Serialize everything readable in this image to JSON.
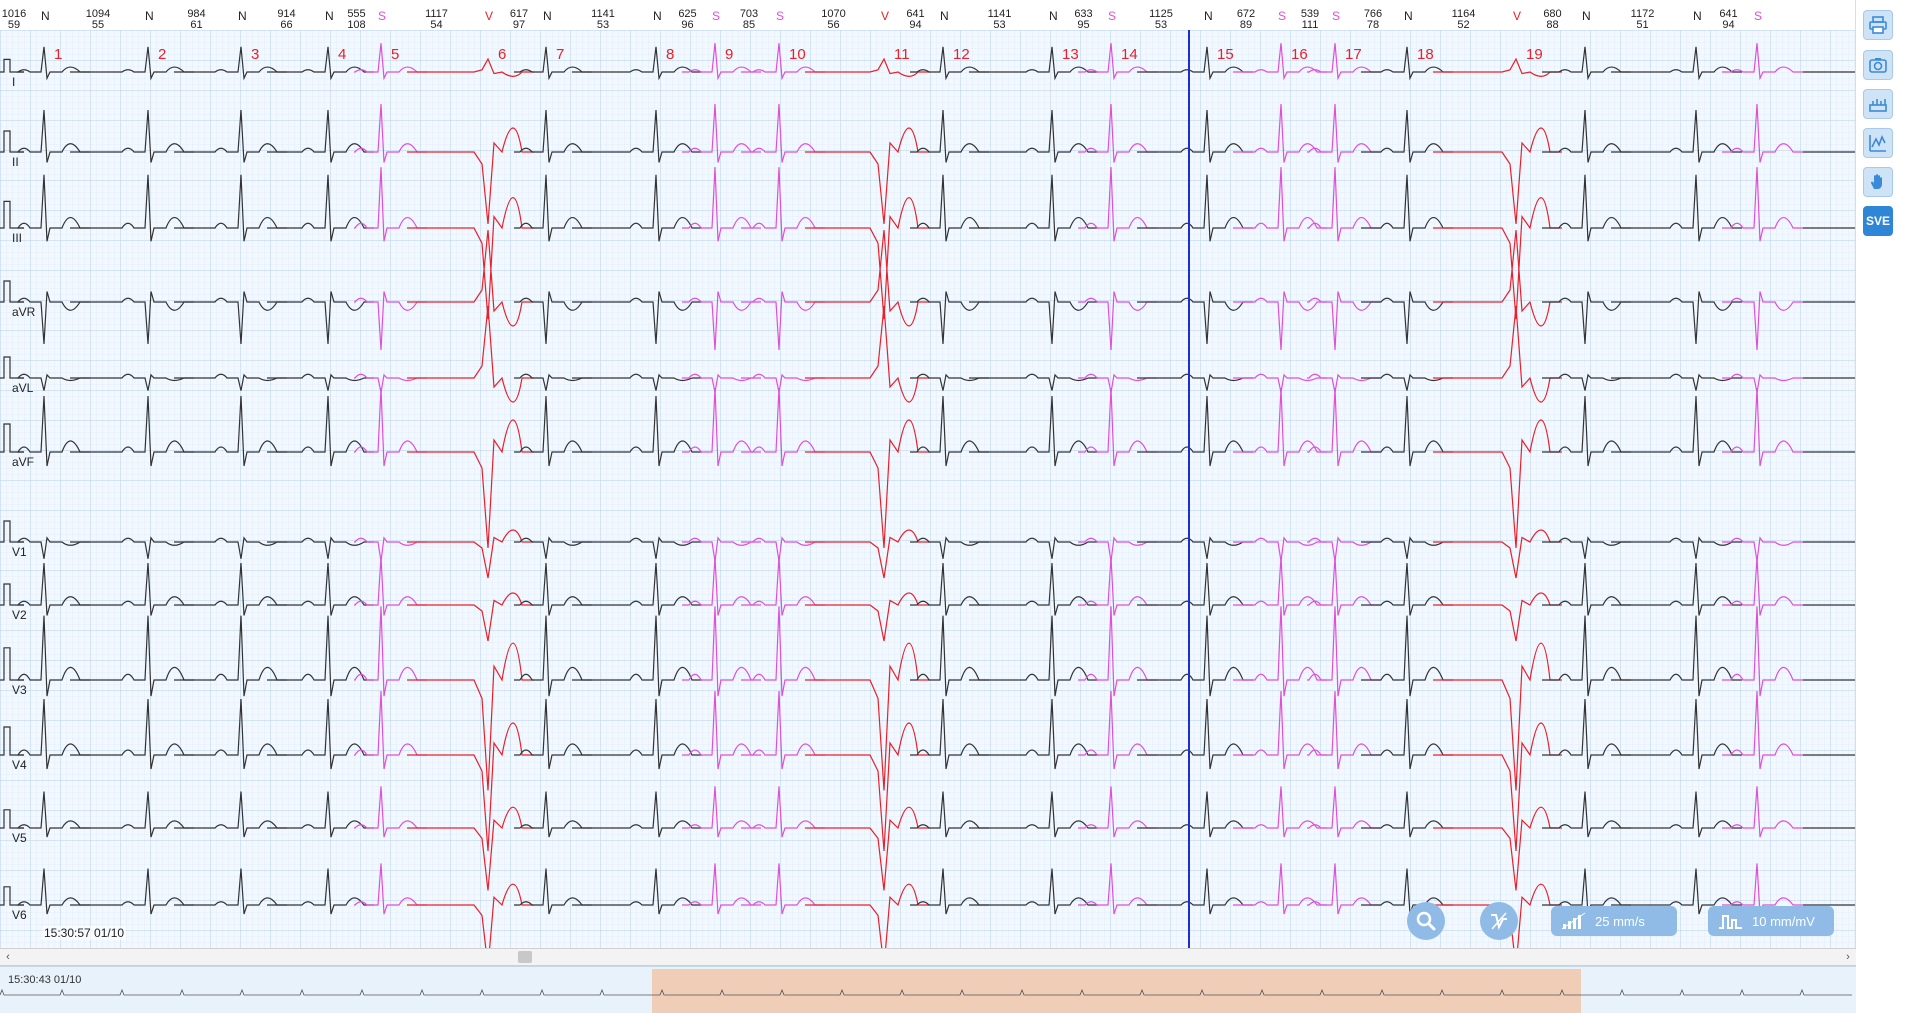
{
  "leads": [
    "I",
    "II",
    "III",
    "aVR",
    "aVL",
    "aVF",
    "V1",
    "V2",
    "V3",
    "V4",
    "V5",
    "V6"
  ],
  "beats": [
    {
      "n": "1",
      "type": "N"
    },
    {
      "n": "2",
      "type": "N"
    },
    {
      "n": "3",
      "type": "N"
    },
    {
      "n": "4",
      "type": "N"
    },
    {
      "n": "5",
      "type": "S"
    },
    {
      "n": "6",
      "type": "V"
    },
    {
      "n": "7",
      "type": "N"
    },
    {
      "n": "8",
      "type": "N"
    },
    {
      "n": "9",
      "type": "S"
    },
    {
      "n": "10",
      "type": "S"
    },
    {
      "n": "11",
      "type": "V"
    },
    {
      "n": "12",
      "type": "N"
    },
    {
      "n": "13",
      "type": "N"
    },
    {
      "n": "14",
      "type": "S"
    },
    {
      "n": "15",
      "type": "N"
    },
    {
      "n": "16",
      "type": "S"
    },
    {
      "n": "17",
      "type": "S"
    },
    {
      "n": "18",
      "type": "N"
    },
    {
      "n": "19",
      "type": "V"
    },
    {
      "n": "",
      "type": "N"
    },
    {
      "n": "",
      "type": "N"
    },
    {
      "n": "",
      "type": "S"
    }
  ],
  "intervals": [
    {
      "rr": "1016",
      "hr": "59"
    },
    {
      "rr": "1094",
      "hr": "55"
    },
    {
      "rr": "984",
      "hr": "61"
    },
    {
      "rr": "914",
      "hr": "66"
    },
    {
      "rr": "555",
      "hr": "108"
    },
    {
      "rr": "1117",
      "hr": "54"
    },
    {
      "rr": "617",
      "hr": "97"
    },
    {
      "rr": "1141",
      "hr": "53"
    },
    {
      "rr": "625",
      "hr": "96"
    },
    {
      "rr": "703",
      "hr": "85"
    },
    {
      "rr": "1070",
      "hr": "56"
    },
    {
      "rr": "641",
      "hr": "94"
    },
    {
      "rr": "1141",
      "hr": "53"
    },
    {
      "rr": "633",
      "hr": "95"
    },
    {
      "rr": "1125",
      "hr": "53"
    },
    {
      "rr": "672",
      "hr": "89"
    },
    {
      "rr": "539",
      "hr": "111"
    },
    {
      "rr": "766",
      "hr": "78"
    },
    {
      "rr": "1164",
      "hr": "52"
    },
    {
      "rr": "680",
      "hr": "88"
    },
    {
      "rr": "1172",
      "hr": "51"
    },
    {
      "rr": "641",
      "hr": "94"
    }
  ],
  "timestamp": "15:30:57 01/10",
  "overview_time": "15:30:43 01/10",
  "controls": {
    "speed_label": "25 mm/s",
    "gain_label": "10 mm/mV"
  },
  "toolbar": {
    "sve_label": "SVE",
    "icons": [
      "print-icon",
      "camera-icon",
      "ruler-icon",
      "measure-icon",
      "hand-icon"
    ]
  },
  "colors": {
    "normal": "#333333",
    "sve": "#e04fd6",
    "ve": "#e8202a",
    "grid_minor": "#cfe1f3",
    "grid_major": "#a9c9ea",
    "cursor": "#1b2fd6",
    "background": "#f2f8fe",
    "accent": "#2f86d6"
  }
}
